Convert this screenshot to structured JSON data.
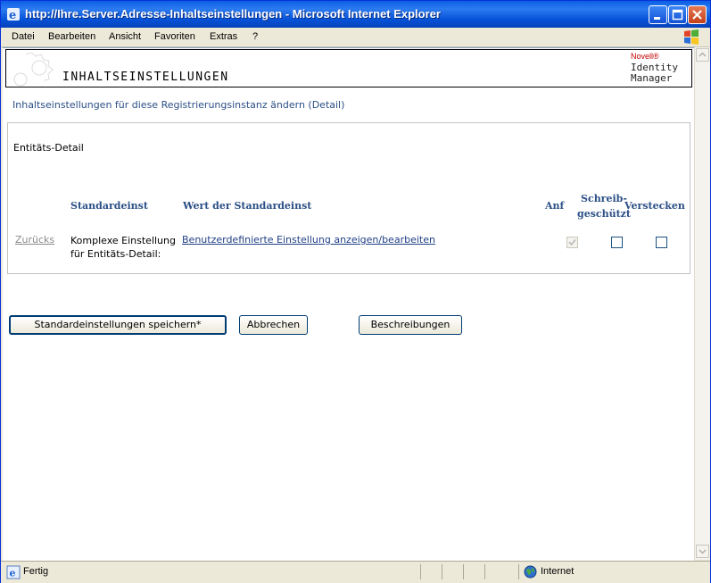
{
  "window": {
    "title": "http://Ihre.Server.Adresse-Inhaltseinstellungen - Microsoft Internet Explorer"
  },
  "menu": [
    "Datei",
    "Bearbeiten",
    "Ansicht",
    "Favoriten",
    "Extras",
    "?"
  ],
  "header": {
    "page_title": "INHALTSEINSTELLUNGEN",
    "brand_novell": "Novell®",
    "brand_product_line1": "Identity",
    "brand_product_line2": "Manager"
  },
  "subtitle": "Inhaltseinstellungen für diese Registrierungsinstanz ändern (Detail)",
  "panel": {
    "title": "Entitäts-Detail",
    "columns": {
      "default_setting": "Standardeinst",
      "default_value": "Wert der Standardeinst",
      "required": "Anf",
      "readonly_line1": "Schreib-",
      "readonly_line2": "geschützt",
      "hide": "Verstecken"
    },
    "row": {
      "back_link": "Zurücks",
      "label_line1": "Komplexe Einstellung",
      "label_line2": "für Entitäts-Detail:",
      "value_link": "Benutzerdefinierte Einstellung anzeigen/bearbeiten",
      "required_checked": true,
      "required_disabled": true,
      "readonly_checked": false,
      "hide_checked": false
    }
  },
  "buttons": {
    "save": "Standardeinstellungen speichern*",
    "cancel": "Abbrechen",
    "descriptions": "Beschreibungen"
  },
  "status": {
    "left": "Fertig",
    "zone": "Internet"
  }
}
